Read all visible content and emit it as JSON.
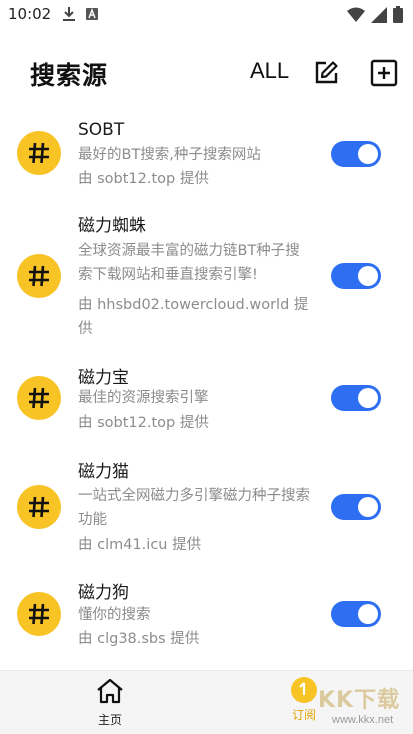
{
  "status_bar": {
    "time": "10:02"
  },
  "header": {
    "title": "搜索源",
    "all_label": "ALL"
  },
  "sources": [
    {
      "title": "SOBT",
      "desc": "最好的BT搜索,种子搜索网站",
      "provider": "由 sobt12.top 提供",
      "enabled": true
    },
    {
      "title": "磁力蜘蛛",
      "desc": "全球资源最丰富的磁力链BT种子搜索下载网站和垂直搜索引擎!",
      "provider": "由 hhsbd02.towercloud.world 提供",
      "enabled": true
    },
    {
      "title": "磁力宝",
      "desc": "最佳的资源搜索引擎",
      "provider": "由 sobt12.top 提供",
      "enabled": true
    },
    {
      "title": "磁力猫",
      "desc": "一站式全网磁力多引擎磁力种子搜索功能",
      "provider": "由 clm41.icu 提供",
      "enabled": true
    },
    {
      "title": "磁力狗",
      "desc": "懂你的搜索",
      "provider": "由 clg38.sbs 提供",
      "enabled": true
    }
  ],
  "bottom_nav": {
    "home_label": "主页",
    "subscribe_label": "订阅"
  },
  "watermark": {
    "text": "KK下载",
    "url": "www.kkx.net"
  },
  "colors": {
    "accent_blue": "#2d6ef2",
    "avatar_yellow": "#f7c325"
  },
  "icons": {
    "avatar": "hash-icon",
    "edit": "edit-icon",
    "add": "add-box-icon",
    "home": "home-icon"
  }
}
